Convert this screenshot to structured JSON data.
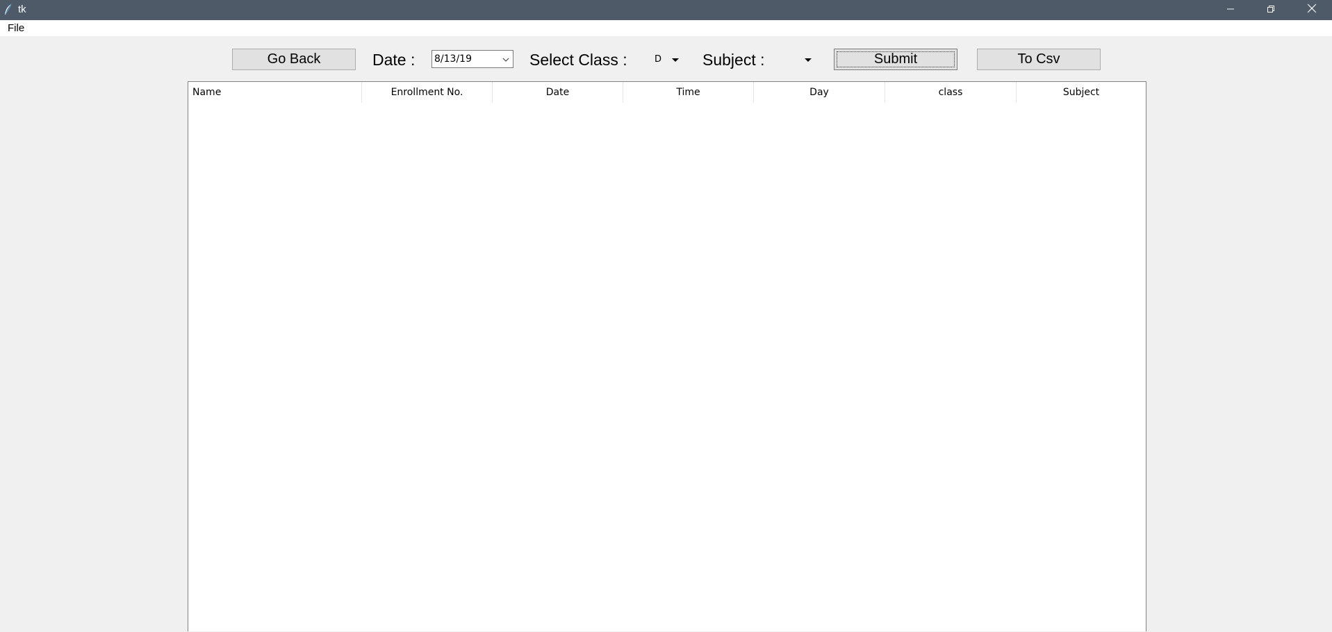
{
  "window": {
    "title": "tk",
    "icons": [
      "feather-icon",
      "minimize-icon",
      "maximize-icon",
      "close-icon"
    ]
  },
  "menu": {
    "file_label": "File"
  },
  "toolbar": {
    "go_back_label": "Go Back",
    "date_label": "Date :",
    "date_value": "8/13/19",
    "select_class_label": "Select Class :",
    "class_value": "D",
    "subject_label": "Subject :",
    "subject_value": "",
    "submit_label": "Submit",
    "to_csv_label": "To Csv"
  },
  "table": {
    "columns": [
      "Name",
      "Enrollment No.",
      "Date",
      "Time",
      "Day",
      "class",
      "Subject"
    ],
    "rows": []
  },
  "colors": {
    "titlebar": "#4f5a69",
    "background": "#f0f0f0",
    "button": "#e1e1e1"
  }
}
